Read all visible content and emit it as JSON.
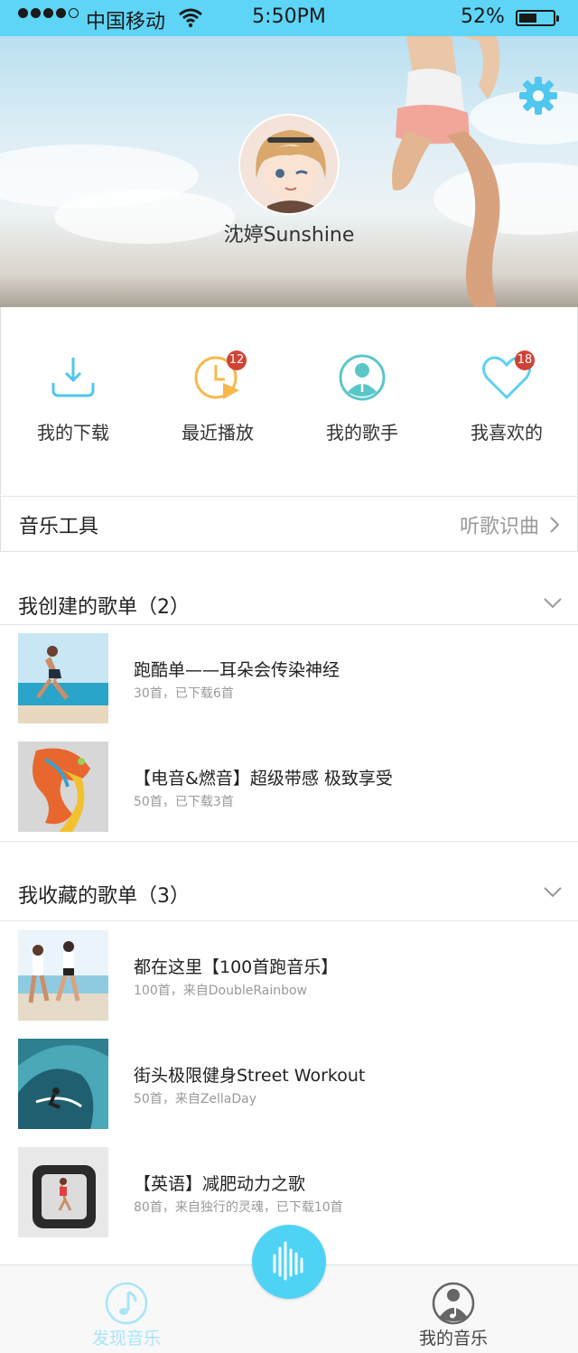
{
  "status_bar": {
    "carrier": "中国移动",
    "time": "5:50PM",
    "battery_percent": "52%",
    "battery_level": 0.52
  },
  "profile": {
    "username": "沈婷Sunshine"
  },
  "quick_actions": [
    {
      "label": "我的下载",
      "icon": "download-icon",
      "badge": ""
    },
    {
      "label": "最近播放",
      "icon": "recent-play-icon",
      "badge": "12"
    },
    {
      "label": "我的歌手",
      "icon": "singer-icon",
      "badge": ""
    },
    {
      "label": "我喜欢的",
      "icon": "heart-icon",
      "badge": "18"
    }
  ],
  "music_tools": {
    "title": "音乐工具",
    "link": "听歌识曲"
  },
  "created_playlists": {
    "title": "我创建的歌单（2）",
    "items": [
      {
        "name": "跑酷单——耳朵会传染神经",
        "sub": "30首，已下载6首"
      },
      {
        "name": "【电音&燃音】超级带感 极致享受",
        "sub": "50首，已下载3首"
      }
    ]
  },
  "collected_playlists": {
    "title": "我收藏的歌单（3）",
    "items": [
      {
        "name": "都在这里【100首跑音乐】",
        "sub": "100首，来自DoubleRainbow"
      },
      {
        "name": "街头极限健身Street Workout",
        "sub": "50首，来自ZellaDay"
      },
      {
        "name": "【英语】减肥动力之歌",
        "sub": "80首，来自独行的灵魂，已下载10首"
      }
    ]
  },
  "tab_bar": {
    "discover": "发现音乐",
    "mine": "我的音乐"
  },
  "colors": {
    "accent": "#4fd3f5",
    "status_bar": "#5ed5f7",
    "badge": "#cf4334",
    "recent_orange": "#f6b94a"
  }
}
